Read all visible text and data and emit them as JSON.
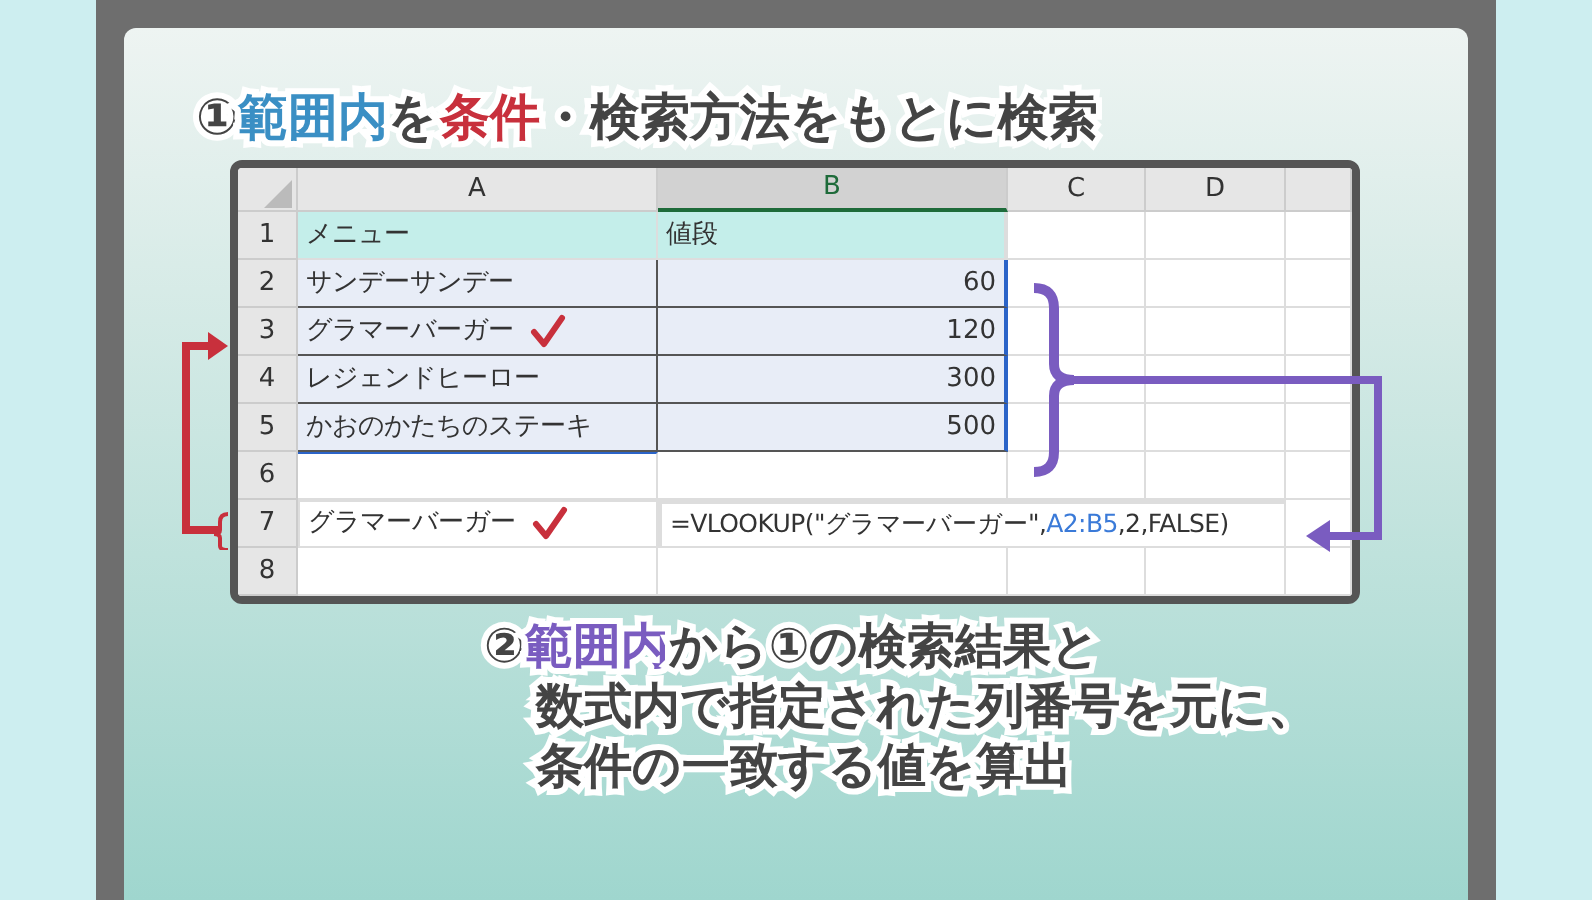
{
  "title": [
    {
      "text": "①",
      "kind": "plain"
    },
    {
      "text": "範囲内",
      "kind": "range"
    },
    {
      "text": "を",
      "kind": "plain"
    },
    {
      "text": "条件",
      "kind": "condition"
    },
    {
      "text": "・検索方法をもとに検索",
      "kind": "plain"
    }
  ],
  "sheet": {
    "columns": [
      {
        "label": "A",
        "selected": false
      },
      {
        "label": "B",
        "selected": true
      },
      {
        "label": "C",
        "selected": false
      },
      {
        "label": "D",
        "selected": false
      }
    ],
    "rows": [
      {
        "number": "1",
        "kind": "header",
        "in_range": false,
        "cells": [
          "メニュー",
          "値段"
        ],
        "checked": false
      },
      {
        "number": "2",
        "kind": "data",
        "in_range": true,
        "cells": [
          "サンデーサンデー",
          "60"
        ],
        "checked": false
      },
      {
        "number": "3",
        "kind": "data",
        "in_range": true,
        "cells": [
          "グラマーバーガー",
          "120"
        ],
        "checked": true
      },
      {
        "number": "4",
        "kind": "data",
        "in_range": true,
        "cells": [
          "レジェンドヒーロー",
          "300"
        ],
        "checked": false
      },
      {
        "number": "5",
        "kind": "data",
        "in_range": true,
        "cells": [
          "かおのかたちのステーキ",
          "500"
        ],
        "checked": false
      },
      {
        "number": "6",
        "kind": "blank",
        "in_range": false,
        "cells": [],
        "checked": false
      },
      {
        "number": "7",
        "kind": "formula",
        "in_range": false,
        "cells": [
          "グラマーバーガー"
        ],
        "checked": true,
        "formula": [
          {
            "text": "=VLOOKUP(\"グラマーバーガー\",",
            "kind": "plain"
          },
          {
            "text": "A2:B5",
            "kind": "ref"
          },
          {
            "text": ",2,FALSE)",
            "kind": "plain"
          }
        ]
      },
      {
        "number": "8",
        "kind": "blank",
        "in_range": false,
        "cells": [],
        "checked": false
      }
    ]
  },
  "caption": [
    [
      {
        "text": "②",
        "kind": "plain"
      },
      {
        "text": "範囲内",
        "kind": "range"
      },
      {
        "text": "から①の検索結果と",
        "kind": "plain"
      }
    ],
    [
      {
        "text": "数式内で指定された列番号を元に、",
        "kind": "plain"
      }
    ],
    [
      {
        "text": "条件の一致する値を算出",
        "kind": "plain"
      }
    ]
  ]
}
